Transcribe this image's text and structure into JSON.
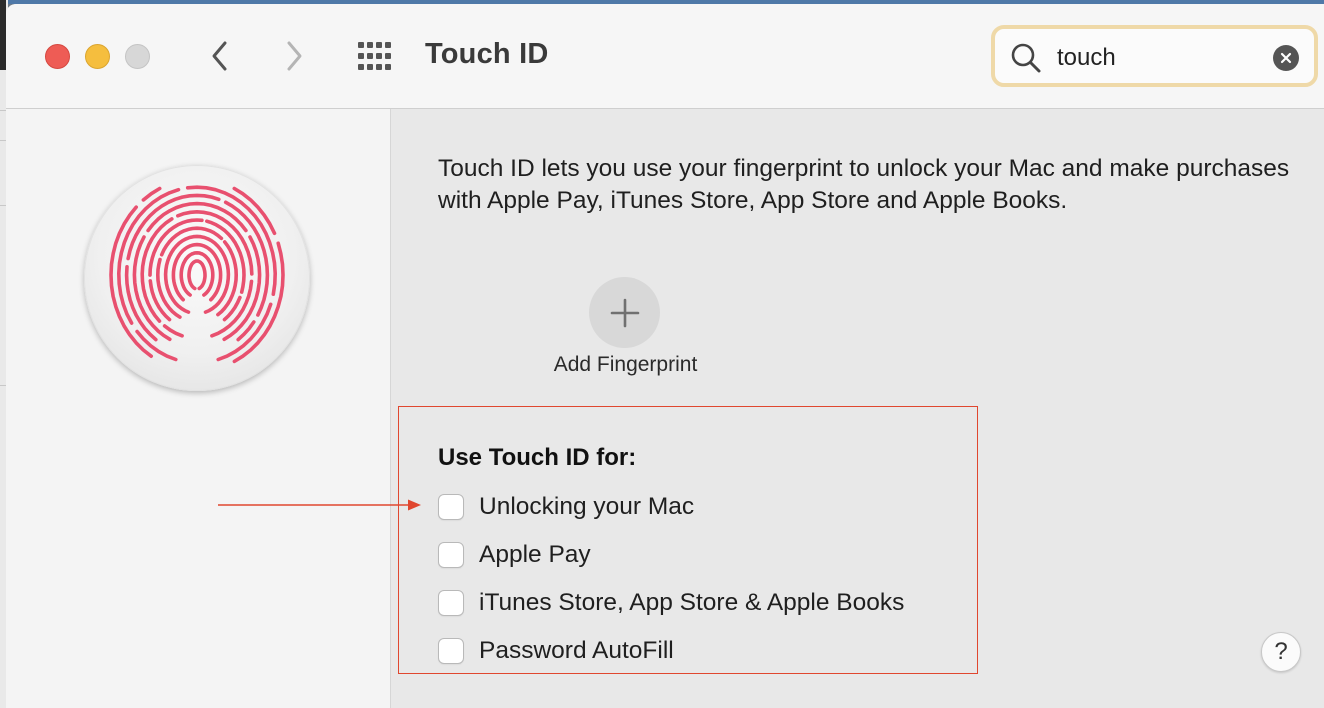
{
  "window": {
    "title": "Touch ID"
  },
  "search": {
    "value": "touch"
  },
  "main": {
    "description": "Touch ID lets you use your fingerprint to unlock your Mac and make purchases with Apple Pay, iTunes Store, App Store and Apple Books.",
    "add_fingerprint_label": "Add Fingerprint",
    "use_heading": "Use Touch ID for:",
    "options": [
      {
        "label": "Unlocking your Mac",
        "checked": false
      },
      {
        "label": "Apple Pay",
        "checked": false
      },
      {
        "label": "iTunes Store, App Store & Apple Books",
        "checked": false
      },
      {
        "label": "Password AutoFill",
        "checked": false
      }
    ],
    "help_label": "?"
  },
  "icons": {
    "traffic_lights": [
      "close-icon",
      "minimize-icon",
      "zoom-icon"
    ],
    "nav": [
      "chevron-left-icon",
      "chevron-right-icon",
      "grid-icon"
    ],
    "search": "magnifier-icon",
    "clear": "clear-icon",
    "add": "plus-icon",
    "sidebar": "fingerprint-icon",
    "annotation": "arrow-icon"
  },
  "colors": {
    "fingerprint": "#e8506f",
    "search_focus_ring": "#efd9a8",
    "annotation": "#e0472f",
    "close": "#ee5c55",
    "minimize": "#f5be3e",
    "zoom": "#d7d7d7"
  }
}
